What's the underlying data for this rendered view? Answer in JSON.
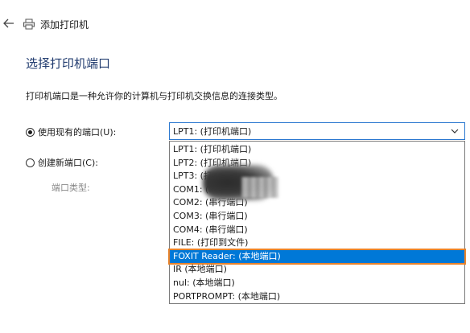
{
  "window": {
    "title": "添加打印机"
  },
  "page": {
    "heading": "选择打印机端口",
    "description": "打印机端口是一种允许你的计算机与打印机交换信息的连接类型。"
  },
  "options": {
    "use_existing_label": "使用现有的端口(U):",
    "use_existing_selected": true,
    "create_new_label": "创建新端口(C):",
    "create_new_selected": false,
    "port_type_label": "端口类型:"
  },
  "port_select": {
    "value": "LPT1: (打印机端口)",
    "highlighted_index": 8,
    "items": [
      "LPT1: (打印机端口)",
      "LPT2: (打印机端口)",
      "LPT3: (打印机端口)",
      "COM1: (串行端口)",
      "COM2: (串行端口)",
      "COM3: (串行端口)",
      "COM4: (串行端口)",
      "FILE: (打印到文件)",
      "FOXIT Reader: (本地端口)",
      "IR (本地端口)",
      "nul: (本地端口)",
      "PORTPROMPT: (本地端口)"
    ]
  },
  "icons": {
    "back": "back-arrow-icon",
    "printer": "printer-icon",
    "dropdown": "chevron-down-icon"
  },
  "colors": {
    "accent": "#0078d7",
    "highlight_border": "#e8832b",
    "heading": "#1f3a6e"
  }
}
